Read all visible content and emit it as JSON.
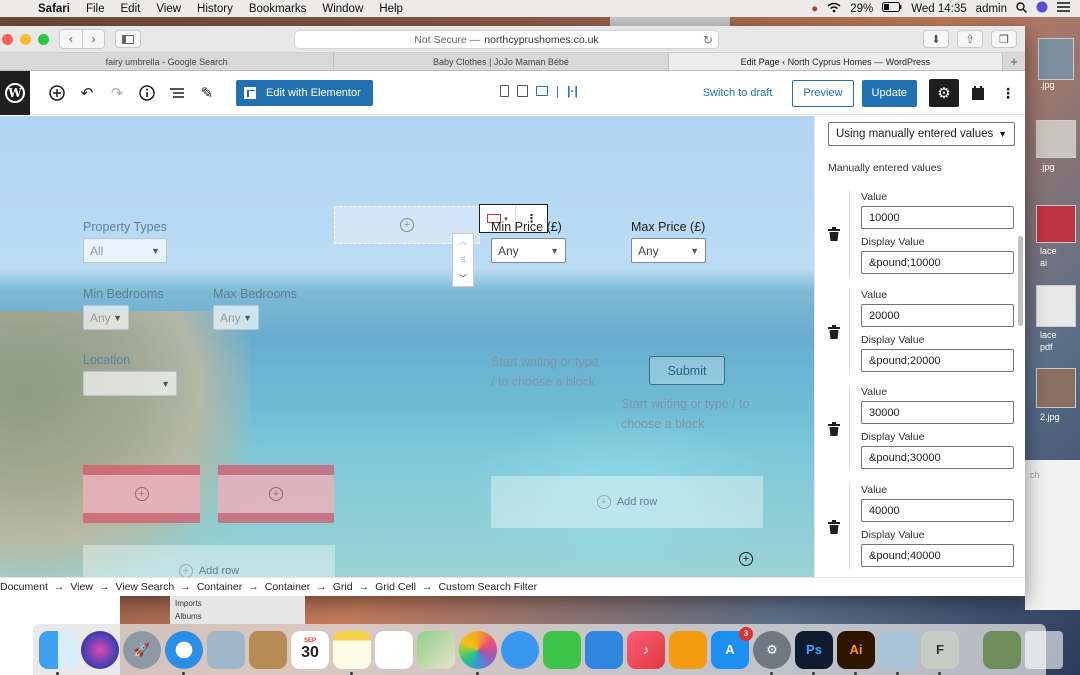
{
  "menubar": {
    "app": "Safari",
    "items": [
      "File",
      "Edit",
      "View",
      "History",
      "Bookmarks",
      "Window",
      "Help"
    ],
    "battery": "29%",
    "clock": "Wed 14:35",
    "user": "admin"
  },
  "browser": {
    "url_prefix": "Not Secure —",
    "url": "northcyprushomes.co.uk",
    "tabs": [
      {
        "title": "fairy umbrella - Google Search"
      },
      {
        "title": "Baby Clothes | JoJo Maman Bébé"
      },
      {
        "title": "Edit Page ‹ North Cyprus Homes — WordPress"
      }
    ]
  },
  "wp_toolbar": {
    "elementor_label": "Edit with Elementor",
    "switch_draft": "Switch to draft",
    "preview": "Preview",
    "update": "Update"
  },
  "canvas": {
    "property_types_label": "Property Types",
    "property_types_value": "All",
    "min_price_label": "Min Price (£)",
    "min_price_value": "Any",
    "max_price_label": "Max Price (£)",
    "max_price_value": "Any",
    "min_bed_label": "Min Bedrooms",
    "min_bed_value": "Any",
    "max_bed_label": "Max Bedrooms",
    "max_bed_value": "Any",
    "location_label": "Location",
    "placeholder_1": "Start writing or type / to choose a block",
    "placeholder_2": "Start writing or type / to choose a block",
    "submit": "Submit",
    "add_row_1": "Add row",
    "add_row_2": "Add row"
  },
  "sidebar": {
    "source_select": "Using manually entered values",
    "heading": "Manually entered values",
    "value_label": "Value",
    "display_label": "Display Value",
    "entries": [
      {
        "value": "10000",
        "display": "&pound;10000"
      },
      {
        "value": "20000",
        "display": "&pound;20000"
      },
      {
        "value": "30000",
        "display": "&pound;30000"
      },
      {
        "value": "40000",
        "display": "&pound;40000"
      }
    ]
  },
  "breadcrumb": [
    "Document",
    "View",
    "View Search",
    "Container",
    "Container",
    "Grid",
    "Grid Cell",
    "Custom Search Filter"
  ],
  "desktop": {
    "labels": [
      ".jpg",
      ".jpg",
      "lace",
      "ai",
      "lace",
      "pdf",
      "2.jpg"
    ],
    "behind_window_text": "Imports",
    "behind_window_section": "Albums",
    "search_hint": "ch"
  },
  "dock": {
    "calendar_month": "SEP",
    "calendar_day": "30",
    "appstore_badge": "3",
    "ps_label": "Ps",
    "ai_label": "Ai"
  }
}
